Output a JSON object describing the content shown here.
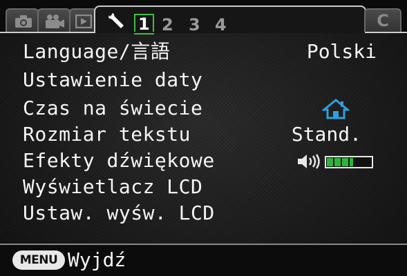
{
  "tabs": {
    "camera_icon": "camera-icon",
    "video_icon": "video-camera-icon",
    "playback_icon": "playback-icon",
    "setup_icon": "wrench-icon",
    "pages": [
      "1",
      "2",
      "3",
      "4"
    ],
    "active_page": "1",
    "custom_label": "C"
  },
  "menu": {
    "items": [
      {
        "label": "Language/言語",
        "value": "Polski"
      },
      {
        "label": "Ustawienie daty",
        "value": ""
      },
      {
        "label": "Czas na świecie",
        "value": "",
        "icon": "home-icon"
      },
      {
        "label": "Rozmiar tekstu",
        "value": "Stand."
      },
      {
        "label": "Efekty dźwiękowe",
        "value": "",
        "icon": "speaker-icon",
        "volume_level": 3,
        "volume_max": 5
      },
      {
        "label": "Wyświetlacz LCD",
        "value": ""
      },
      {
        "label": "Ustaw. wyśw. LCD",
        "value": ""
      }
    ]
  },
  "footer": {
    "menu_key": "MENU",
    "exit_label": "Wyjdź"
  },
  "colors": {
    "active_page_border": "#3cc04a",
    "home_icon": "#2f9fe0",
    "volume_fill": "#2fb63a"
  }
}
